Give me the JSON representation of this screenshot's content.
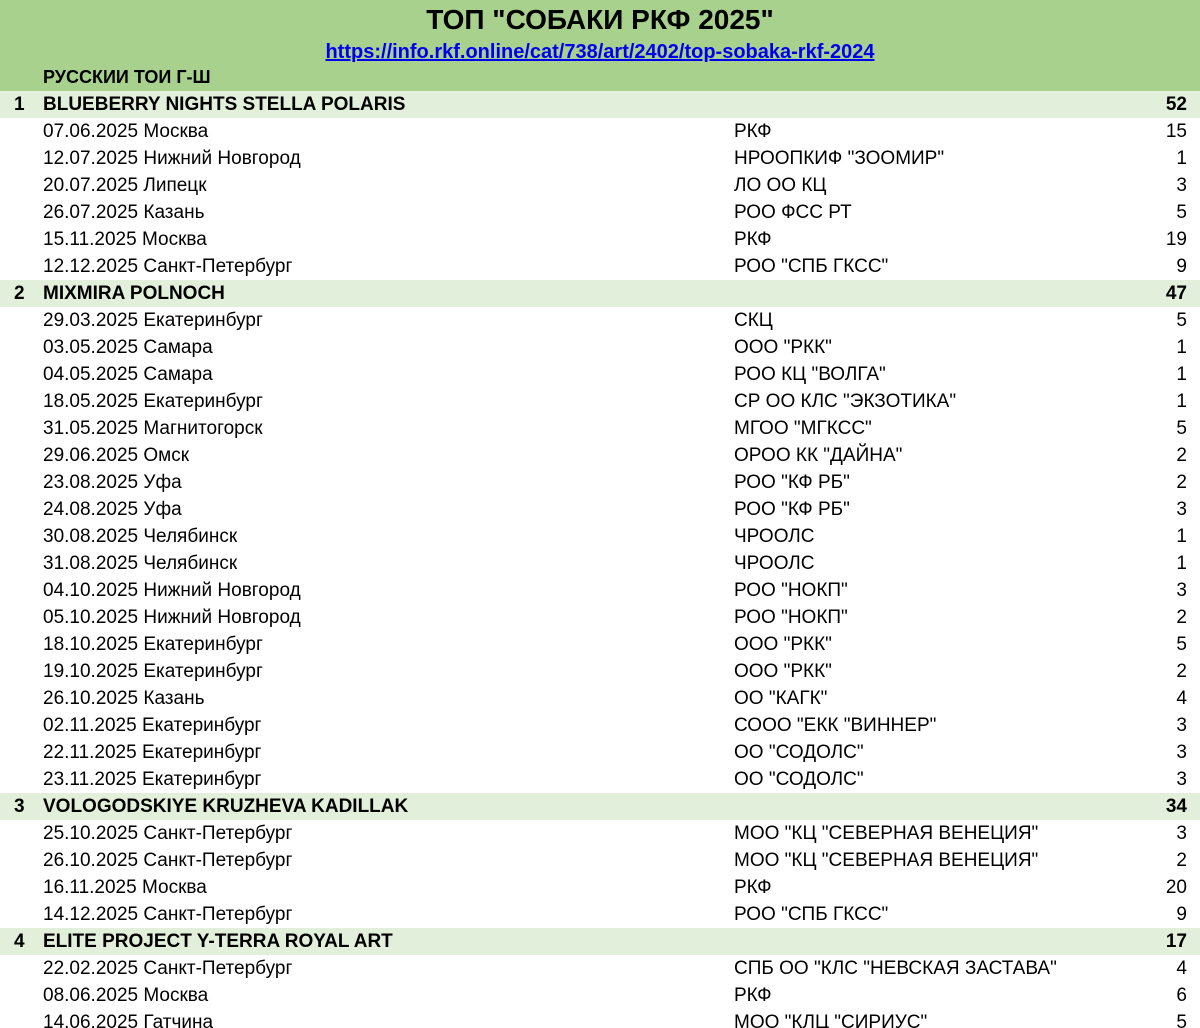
{
  "header": {
    "title": "ТОП \"СОБАКИ РКФ 2025\"",
    "link": "https://info.rkf.online/cat/738/art/2402/top-sobaka-rkf-2024",
    "breed": "РУССКИИ ТОИ Г-Ш"
  },
  "rows": [
    {
      "type": "dog",
      "rank": "1",
      "name": "BLUEBERRY NIGHTS STELLA POLARIS",
      "points": "52"
    },
    {
      "type": "show",
      "date": "07.06.2025 Москва",
      "org": " РКФ",
      "points": "15"
    },
    {
      "type": "show",
      "date": "12.07.2025 Нижний Новгород",
      "org": "НРООПКИФ \"ЗООМИР\"",
      "points": "1"
    },
    {
      "type": "show",
      "date": "20.07.2025 Липецк",
      "org": "ЛО ОО КЦ",
      "points": "3"
    },
    {
      "type": "show",
      "date": "26.07.2025 Казань",
      "org": "РОО ФСС РТ",
      "points": "5"
    },
    {
      "type": "show",
      "date": "15.11.2025 Москва",
      "org": " РКФ",
      "points": "19"
    },
    {
      "type": "show",
      "date": "12.12.2025 Санкт-Петербург",
      "org": "РОО \"СПБ ГКСС\"",
      "points": "9"
    },
    {
      "type": "dog",
      "rank": "2",
      "name": "MIXMIRA POLNOCH",
      "points": "47"
    },
    {
      "type": "show",
      "date": "29.03.2025 Екатеринбург",
      "org": "СКЦ",
      "points": "5"
    },
    {
      "type": "show",
      "date": "03.05.2025 Самара",
      "org": "ООО \"РКК\"",
      "points": "1"
    },
    {
      "type": "show",
      "date": "04.05.2025 Самара",
      "org": "РОО КЦ \"ВОЛГА\"",
      "points": "1"
    },
    {
      "type": "show",
      "date": "18.05.2025 Екатеринбург",
      "org": "СР ОО КЛС \"ЭКЗОТИКА\"",
      "points": "1"
    },
    {
      "type": "show",
      "date": "31.05.2025 Магнитогорск",
      "org": "МГОО \"МГКСС\"",
      "points": "5"
    },
    {
      "type": "show",
      "date": "29.06.2025 Омск",
      "org": "ОРОО КК \"ДАЙНА\"",
      "points": "2"
    },
    {
      "type": "show",
      "date": "23.08.2025 Уфа",
      "org": "РОО \"КФ РБ\"",
      "points": "2"
    },
    {
      "type": "show",
      "date": "24.08.2025 Уфа",
      "org": "РОО \"КФ РБ\"",
      "points": "3"
    },
    {
      "type": "show",
      "date": "30.08.2025 Челябинск",
      "org": "ЧРООЛС",
      "points": "1"
    },
    {
      "type": "show",
      "date": "31.08.2025 Челябинск",
      "org": "ЧРООЛС",
      "points": "1"
    },
    {
      "type": "show",
      "date": "04.10.2025 Нижний Новгород",
      "org": "РОО \"НОКП\"",
      "points": "3"
    },
    {
      "type": "show",
      "date": "05.10.2025 Нижний Новгород",
      "org": "РОО \"НОКП\"",
      "points": "2"
    },
    {
      "type": "show",
      "date": "18.10.2025 Екатеринбург",
      "org": "ООО \"РКК\"",
      "points": "5"
    },
    {
      "type": "show",
      "date": "19.10.2025 Екатеринбург",
      "org": "ООО \"РКК\"",
      "points": "2"
    },
    {
      "type": "show",
      "date": "26.10.2025 Казань",
      "org": "ОО \"КАГК\"",
      "points": "4"
    },
    {
      "type": "show",
      "date": "02.11.2025 Екатеринбург",
      "org": "СООО \"ЕКК \"ВИННЕР\"",
      "points": "3"
    },
    {
      "type": "show",
      "date": "22.11.2025 Екатеринбург",
      "org": "ОО \"СОДОЛС\"",
      "points": "3"
    },
    {
      "type": "show",
      "date": "23.11.2025 Екатеринбург",
      "org": "ОО \"СОДОЛС\"",
      "points": "3"
    },
    {
      "type": "dog",
      "rank": "3",
      "name": "VOLOGODSKIYE KRUZHEVA KADILLAK",
      "points": "34"
    },
    {
      "type": "show",
      "date": "25.10.2025 Санкт-Петербург",
      "org": "МОО \"КЦ \"СЕВЕРНАЯ ВЕНЕЦИЯ\"",
      "points": "3"
    },
    {
      "type": "show",
      "date": "26.10.2025 Санкт-Петербург",
      "org": "МОО \"КЦ \"СЕВЕРНАЯ ВЕНЕЦИЯ\"",
      "points": "2"
    },
    {
      "type": "show",
      "date": "16.11.2025 Москва",
      "org": " РКФ",
      "points": "20"
    },
    {
      "type": "show",
      "date": "14.12.2025 Санкт-Петербург",
      "org": "РОО \"СПБ ГКСС\"",
      "points": "9"
    },
    {
      "type": "dog",
      "rank": "4",
      "name": "ELITE PROJECT Y-TERRA ROYAL ART",
      "points": "17"
    },
    {
      "type": "show",
      "date": "22.02.2025 Санкт-Петербург",
      "org": "СПБ ОО \"КЛС \"НЕВСКАЯ ЗАСТАВА\"",
      "points": "4"
    },
    {
      "type": "show",
      "date": "08.06.2025 Москва",
      "org": " РКФ",
      "points": "6"
    },
    {
      "type": "show",
      "date": "14.06.2025 Гатчина",
      "org": "МОО \"КЛЦ \"СИРИУС\"",
      "points": "5"
    }
  ]
}
